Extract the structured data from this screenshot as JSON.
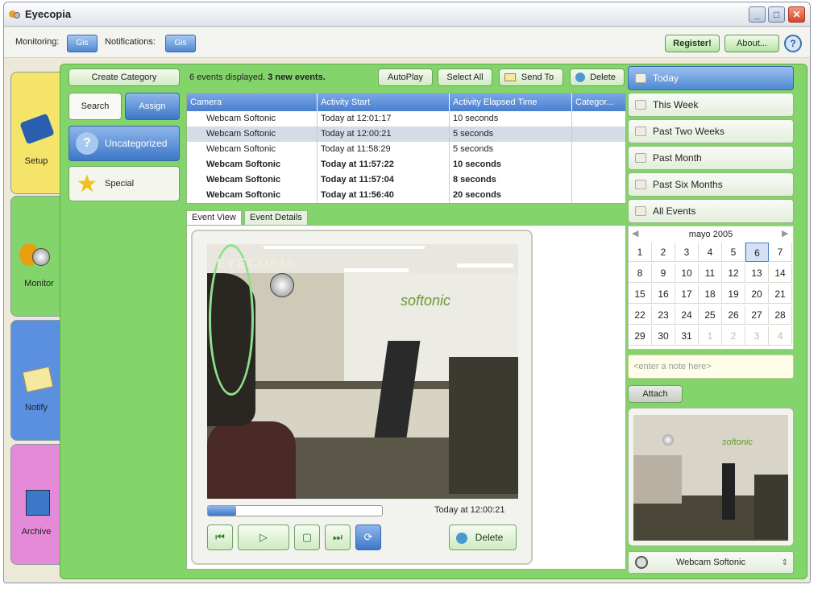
{
  "window": {
    "title": "Eyecopia",
    "min": "_",
    "max": "□",
    "close": "✕"
  },
  "toolbar": {
    "monitoring_label": "Monitoring:",
    "monitoring_toggle": "Gis",
    "notifications_label": "Notifications:",
    "notifications_toggle": "Gis",
    "register": "Register!",
    "about": "About...",
    "help": "?"
  },
  "left_tabs": [
    {
      "label": "Setup",
      "icon": "camera-icon",
      "color": "#f5e46a"
    },
    {
      "label": "Monitor",
      "icon": "monitor-eye-icon",
      "color": "#83d46a"
    },
    {
      "label": "Notify",
      "icon": "envelope-icon",
      "color": "#5b8fe0"
    },
    {
      "label": "Archive",
      "icon": "archive-box-icon",
      "color": "#e48ad8"
    }
  ],
  "categories": {
    "create": "Create Category",
    "search": "Search",
    "assign": "Assign",
    "uncategorized": "Uncategorized",
    "special": "Special"
  },
  "events": {
    "count_text": "6 events displayed.",
    "new_text": "3 new events.",
    "autoplay": "AutoPlay",
    "select_all": "Select All",
    "send_to": "Send To",
    "delete": "Delete",
    "columns": [
      "Camera",
      "Activity Start",
      "Activity Elapsed Time",
      "Categor..."
    ],
    "rows": [
      {
        "camera": "Webcam Softonic",
        "start": "Today at 12:01:17",
        "elapsed": "10 seconds",
        "bold": false,
        "selected": false
      },
      {
        "camera": "Webcam Softonic",
        "start": "Today at 12:00:21",
        "elapsed": "5 seconds",
        "bold": false,
        "selected": true
      },
      {
        "camera": "Webcam Softonic",
        "start": "Today at 11:58:29",
        "elapsed": "5 seconds",
        "bold": false,
        "selected": false
      },
      {
        "camera": "Webcam Softonic",
        "start": "Today at 11:57:22",
        "elapsed": "10 seconds",
        "bold": true,
        "selected": false
      },
      {
        "camera": "Webcam Softonic",
        "start": "Today at 11:57:04",
        "elapsed": "8 seconds",
        "bold": true,
        "selected": false
      },
      {
        "camera": "Webcam Softonic",
        "start": "Today at 11:56:40",
        "elapsed": "20 seconds",
        "bold": true,
        "selected": false
      }
    ]
  },
  "detail_tabs": {
    "event_view": "Event View",
    "event_details": "Event Details"
  },
  "viewer": {
    "overlay_brand": "EYECOPIA",
    "sign_text": "softonic",
    "timestamp": "Today at 12:00:21",
    "delete": "Delete",
    "progress": 0.16
  },
  "time_filters": [
    "Today",
    "This Week",
    "Past Two Weeks",
    "Past Month",
    "Past Six Months",
    "All Events"
  ],
  "calendar": {
    "month": "mayo 2005",
    "selected": 6,
    "days": [
      "1",
      "2",
      "3",
      "4",
      "5",
      "6",
      "7",
      "8",
      "9",
      "10",
      "11",
      "12",
      "13",
      "14",
      "15",
      "16",
      "17",
      "18",
      "19",
      "20",
      "21",
      "22",
      "23",
      "24",
      "25",
      "26",
      "27",
      "28",
      "29",
      "30",
      "31",
      "1",
      "2",
      "3",
      "4"
    ]
  },
  "note": {
    "placeholder": "<enter a note here>",
    "attach": "Attach"
  },
  "camera_select": {
    "value": "Webcam Softonic",
    "preview_sign": "softonic"
  }
}
